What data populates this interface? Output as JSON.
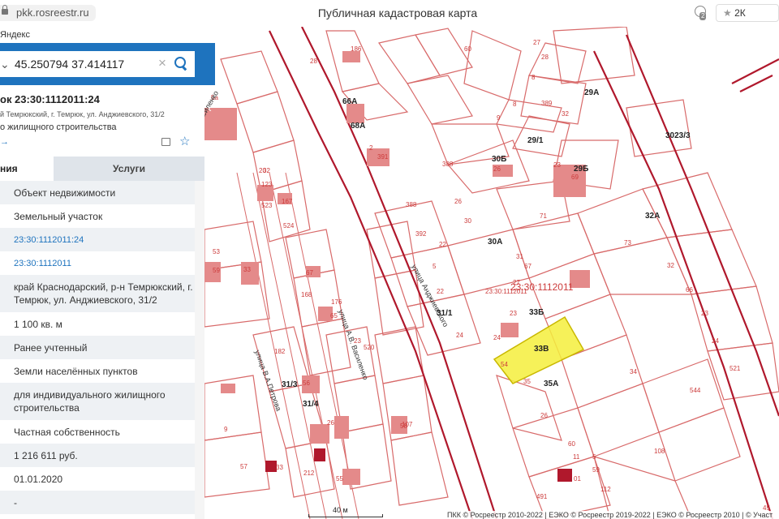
{
  "browser": {
    "url": "pkk.rosreestr.ru",
    "title": "Публичная кадастровая карта",
    "reviews": "2К отзывов",
    "reviews_badge": "2",
    "yandex_label": "Яндекс"
  },
  "search": {
    "value": "45.250794 37.414117"
  },
  "object": {
    "title": "ок 23:30:1112011:24",
    "address": "й Темрюкский, г. Темрюк, ул. Анджиевского, 31/2",
    "purpose": "о жилищного строительства",
    "link_arrow": "→"
  },
  "tabs": {
    "info": "ния",
    "services": "Услуги"
  },
  "properties": [
    {
      "text": "Объект недвижимости",
      "h": 29,
      "alt": true
    },
    {
      "text": "Земельный участок",
      "h": 29,
      "alt": false
    },
    {
      "text": "23:30:1112011:24",
      "h": 29,
      "alt": true,
      "link": true
    },
    {
      "text": "23:30:1112011",
      "h": 29,
      "alt": false,
      "link": true
    },
    {
      "text": "край Краснодарский, р-н Темрюкский, г. Темрюк, ул. Анджиевского, 31/2",
      "h": 46,
      "alt": true
    },
    {
      "text": "1 100 кв. м",
      "h": 29,
      "alt": false
    },
    {
      "text": "Ранее учтенный",
      "h": 29,
      "alt": true
    },
    {
      "text": "Земли населённых пунктов",
      "h": 29,
      "alt": false
    },
    {
      "text": "для индивидуального жилищного строительства",
      "h": 46,
      "alt": true
    },
    {
      "text": "Частная собственность",
      "h": 29,
      "alt": false
    },
    {
      "text": "1 216 611 руб.",
      "h": 29,
      "alt": true
    },
    {
      "text": "01.01.2020",
      "h": 29,
      "alt": false
    },
    {
      "text": "-",
      "h": 29,
      "alt": true
    }
  ],
  "map": {
    "selected_parcel": "23:30:1112011",
    "streets": [
      "улица Анджиевского",
      "улица А.В. Василенко",
      "улица В.А.Петрова",
      "Василенко"
    ],
    "scale": "40 м",
    "footer": "ПКК © Росреестр 2010-2022 | ЕЭКО © Росреестр 2019-2022 | ЕЭКО © Росреестр 2010 | © Участ",
    "labels": [
      "28",
      "186",
      "27",
      "28",
      "60",
      "8",
      "29А",
      "9",
      "8",
      "32",
      "389",
      "29/1",
      "66А",
      "68А",
      "2",
      "391",
      "388",
      "30Б",
      "26",
      "29Б",
      "23",
      "69",
      "3023/3",
      "32",
      "20",
      "123",
      "388",
      "26",
      "523",
      "167",
      "524",
      "30",
      "392",
      "71",
      "32А",
      "22",
      "30А",
      "31",
      "73",
      "5",
      "67",
      "32",
      "33",
      "22",
      "168",
      "67",
      "23:30:1112011",
      "27",
      "33А",
      "66",
      "31/1",
      "23",
      "33Б",
      "23",
      "176",
      "65",
      "24",
      "23",
      "24",
      "33В",
      "54",
      "24",
      "182",
      "520",
      "31/3",
      "56",
      "35",
      "35А",
      "34",
      "521",
      "31/4",
      "544",
      "26",
      "26",
      "107",
      "58",
      "9",
      "60",
      "11",
      "5",
      "108",
      "212",
      "57",
      "33",
      "55",
      "59",
      "01",
      "491",
      "112",
      "45",
      "5а",
      "53",
      "59"
    ],
    "colors": {
      "parcel_line": "#d86a6a",
      "road_line": "#b0182c",
      "building": "#e48a8a",
      "label": "#cc3b3b",
      "selected": "#f4ee3c"
    }
  }
}
